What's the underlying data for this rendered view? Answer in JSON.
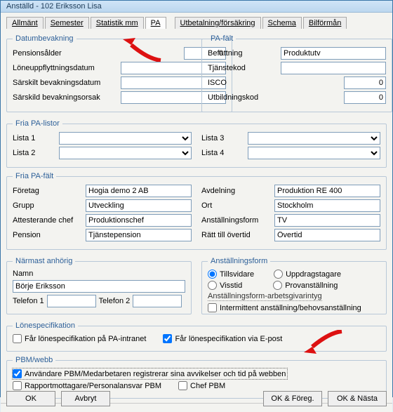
{
  "window": {
    "title": "Anställd - 102  Eriksson Lisa"
  },
  "tabs": {
    "allmant": "Allmänt",
    "semester": "Semester",
    "statistik": "Statistik mm",
    "pa": "PA",
    "utbet": "Utbetalning/försäkring",
    "schema": "Schema",
    "bilforman": "Bilförmån"
  },
  "datumbevakning": {
    "legend": "Datumbevakning",
    "pensionsalder": "Pensionsålder",
    "pensionsalder_val": "0",
    "loneupp": "Löneuppflyttningsdatum",
    "sarskilt": "Särskilt bevakningsdatum",
    "sarskild_orsak": "Särskild bevakningsorsak"
  },
  "pafalt": {
    "legend": "PA-fält",
    "befattning": "Befattning",
    "befattning_val": "Produktutv",
    "tjanstekod": "Tjänstekod",
    "isco": "ISCO",
    "isco_val": "0",
    "utbildning": "Utbildningskod",
    "utbildning_val": "0"
  },
  "fria_listor": {
    "legend": "Fria PA-listor",
    "l1": "Lista 1",
    "l2": "Lista 2",
    "l3": "Lista 3",
    "l4": "Lista 4"
  },
  "fria_falt": {
    "legend": "Fria PA-fält",
    "foretag": "Företag",
    "foretag_val": "Hogia demo 2 AB",
    "grupp": "Grupp",
    "grupp_val": "Utveckling",
    "attchef": "Attesterande chef",
    "attchef_val": "Produktionschef",
    "pension": "Pension",
    "pension_val": "Tjänstepension",
    "avdelning": "Avdelning",
    "avdelning_val": "Produktion RE 400",
    "ort": "Ort",
    "ort_val": "Stockholm",
    "anstform": "Anställningsform",
    "anstform_val": "TV",
    "ratt": "Rätt till övertid",
    "ratt_val": "Övertid"
  },
  "narmast": {
    "legend": "Närmast anhörig",
    "namn": "Namn",
    "namn_val": "Börje Eriksson",
    "tel1": "Telefon 1",
    "tel2": "Telefon 2"
  },
  "anstform": {
    "legend": "Anställningsform",
    "tillsvidare": "Tillsvidare",
    "visstid": "Visstid",
    "uppdrag": "Uppdragstagare",
    "provan": "Provanställning",
    "intyg_link": "Anställningsform-arbetsgivarintyg",
    "intermittent": "Intermittent anställning/behovsanställning"
  },
  "lonespec": {
    "legend": "Lönespecifikation",
    "intranet": "Får lönespecifikation på PA-intranet",
    "epost": "Får lönespecifikation via E-post"
  },
  "pbm": {
    "legend": "PBM/webb",
    "anvandare": "Användare PBM/Medarbetaren registrerar sina avvikelser och tid på webben",
    "rapport": "Rapportmottagare/Personalansvar PBM",
    "chef": "Chef PBM"
  },
  "buttons": {
    "ok": "OK",
    "avbryt": "Avbryt",
    "ok_foreg": "OK & Föreg.",
    "ok_nasta": "OK & Nästa"
  }
}
